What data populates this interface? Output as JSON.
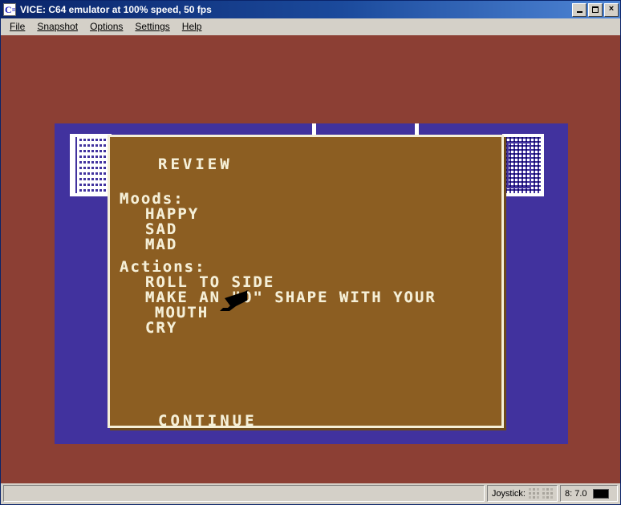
{
  "window": {
    "title": "VICE: C64 emulator at 100% speed, 50 fps",
    "icon": "commodore-logo-icon",
    "buttons": {
      "minimize": "minimize-icon",
      "maximize": "maximize-icon",
      "close": "×"
    }
  },
  "menubar": {
    "items": [
      {
        "label": "File",
        "mnemonic": "F"
      },
      {
        "label": "Snapshot",
        "mnemonic": "S"
      },
      {
        "label": "Options",
        "mnemonic": "O"
      },
      {
        "label": "Settings",
        "mnemonic": "S"
      },
      {
        "label": "Help",
        "mnemonic": "H"
      }
    ]
  },
  "screen": {
    "title": "REVIEW",
    "moods_label": "Moods:",
    "moods": [
      "HAPPY",
      "SAD",
      "MAD"
    ],
    "actions_label": "Actions:",
    "actions": [
      "ROLL TO SIDE",
      "MAKE AN \"O\" SHAPE WITH YOUR",
      "MOUTH",
      "CRY"
    ],
    "continue_label": "CONTINUE",
    "selected_mood": "HAPPY",
    "cursor": "mouse-pointer-arrow"
  },
  "statusbar": {
    "main_text": "",
    "joystick_label": "Joystick:",
    "drive_label": "8: 7.0",
    "drive_led": "off"
  },
  "colors": {
    "titlebar_start": "#0a246a",
    "titlebar_end": "#4f86d6",
    "chrome": "#d4d0c8",
    "c64_outer_border": "#8c3f34",
    "c64_inner_border": "#41329e",
    "c64_panel_bg": "#8c5e22",
    "c64_text": "#f5efd7"
  }
}
